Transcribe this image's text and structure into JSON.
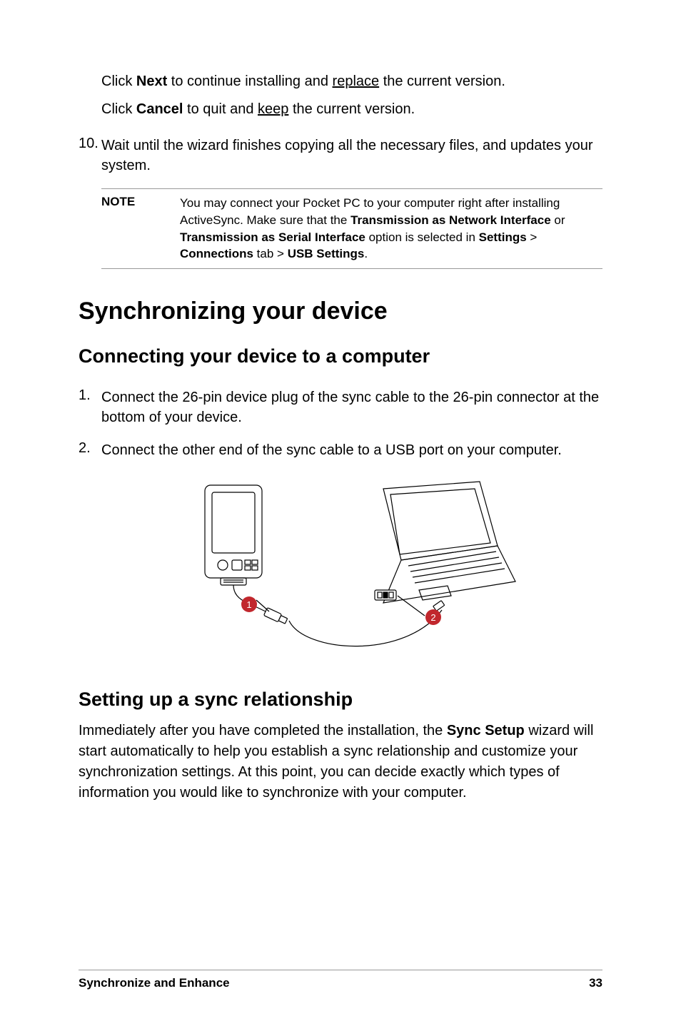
{
  "indent1_pre": "Click ",
  "indent1_bold": "Next",
  "indent1_mid": " to continue installing and ",
  "indent1_u": "replace",
  "indent1_post": " the current version.",
  "indent2_pre": "Click ",
  "indent2_bold": "Cancel",
  "indent2_mid": " to quit and ",
  "indent2_u": "keep",
  "indent2_post": " the current version.",
  "step10_num": "10.",
  "step10_text": "Wait until the wizard finishes copying all the necessary files, and updates your system.",
  "note_label": "NOTE",
  "note_a": "You may connect your Pocket PC to your computer right after installing ActiveSync. Make sure that the ",
  "note_b1": "Transmission as Network Interface",
  "note_or": " or ",
  "note_b2": "Transmission as Serial Interface",
  "note_c": " option is selected in ",
  "note_b3": "Settings",
  "note_gt1": " > ",
  "note_b4": "Connections",
  "note_tab": " tab > ",
  "note_b5": "USB Settings",
  "note_end": ".",
  "h1": "Synchronizing your device",
  "h2a": "Connecting your device to a computer",
  "s1_num": "1.",
  "s1_text": "Connect the 26-pin device plug of the sync cable to the 26-pin connector at the bottom of your device.",
  "s2_num": "2.",
  "s2_text": "Connect the other end of the sync cable to a USB port on your computer.",
  "h2b": "Setting up a sync relationship",
  "para_a": "Immediately after you have completed the installation, the ",
  "para_b": "Sync Setup",
  "para_c": " wizard will start automatically to help you establish a sync relationship and customize your synchronization settings. At this point, you can decide exactly which types of information you would like to synchronize with your computer.",
  "footer_left": "Synchronize and Enhance",
  "footer_right": "33",
  "badge1": "1",
  "badge2": "2"
}
